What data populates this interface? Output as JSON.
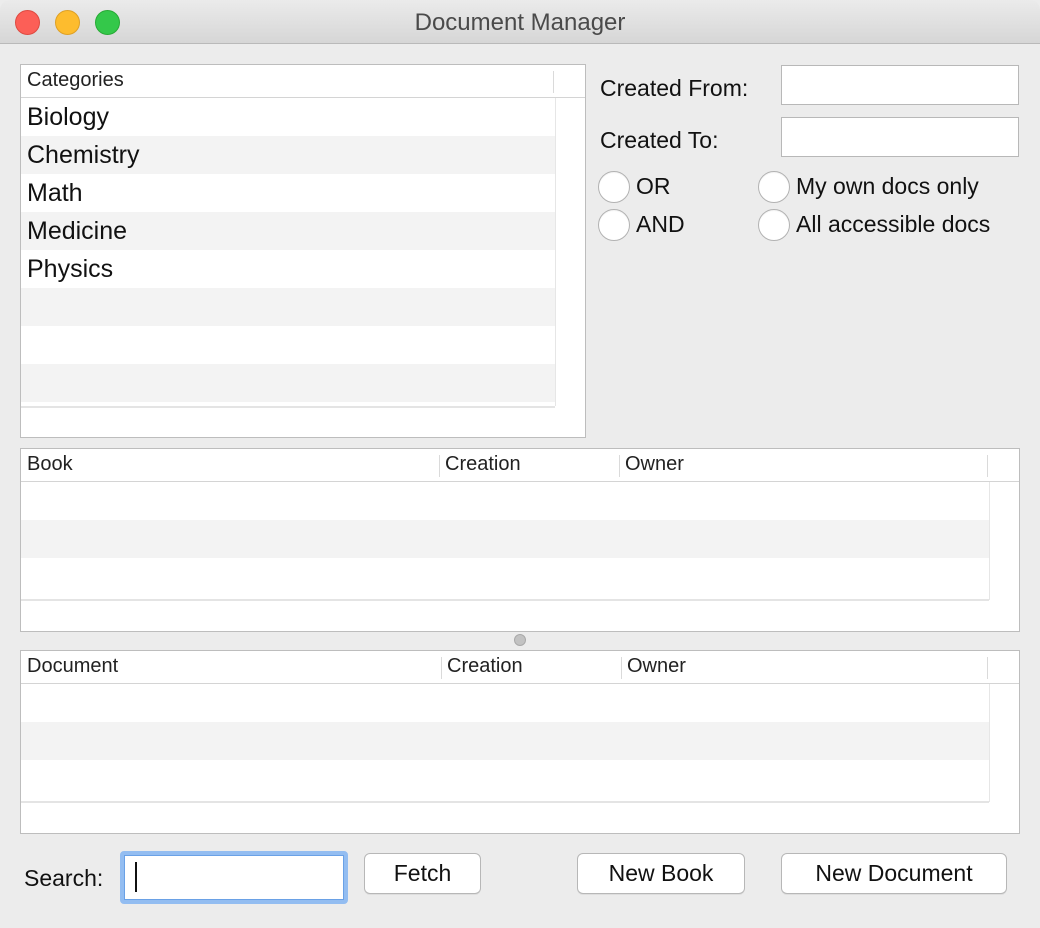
{
  "window": {
    "title": "Document Manager"
  },
  "categories": {
    "header": "Categories",
    "items": [
      "Biology",
      "Chemistry",
      "Math",
      "Medicine",
      "Physics"
    ]
  },
  "filters": {
    "created_from_label": "Created From:",
    "created_to_label": "Created To:",
    "created_from_value": "",
    "created_to_value": "",
    "logic_options": [
      "OR",
      "AND"
    ],
    "scope_options": [
      "My own docs only",
      "All accessible docs"
    ]
  },
  "books_table": {
    "columns": [
      "Book",
      "Creation",
      "Owner"
    ],
    "rows": []
  },
  "documents_table": {
    "columns": [
      "Document",
      "Creation",
      "Owner"
    ],
    "rows": []
  },
  "search": {
    "label": "Search:",
    "value": ""
  },
  "buttons": {
    "fetch": "Fetch",
    "new_book": "New Book",
    "new_document": "New Document"
  }
}
